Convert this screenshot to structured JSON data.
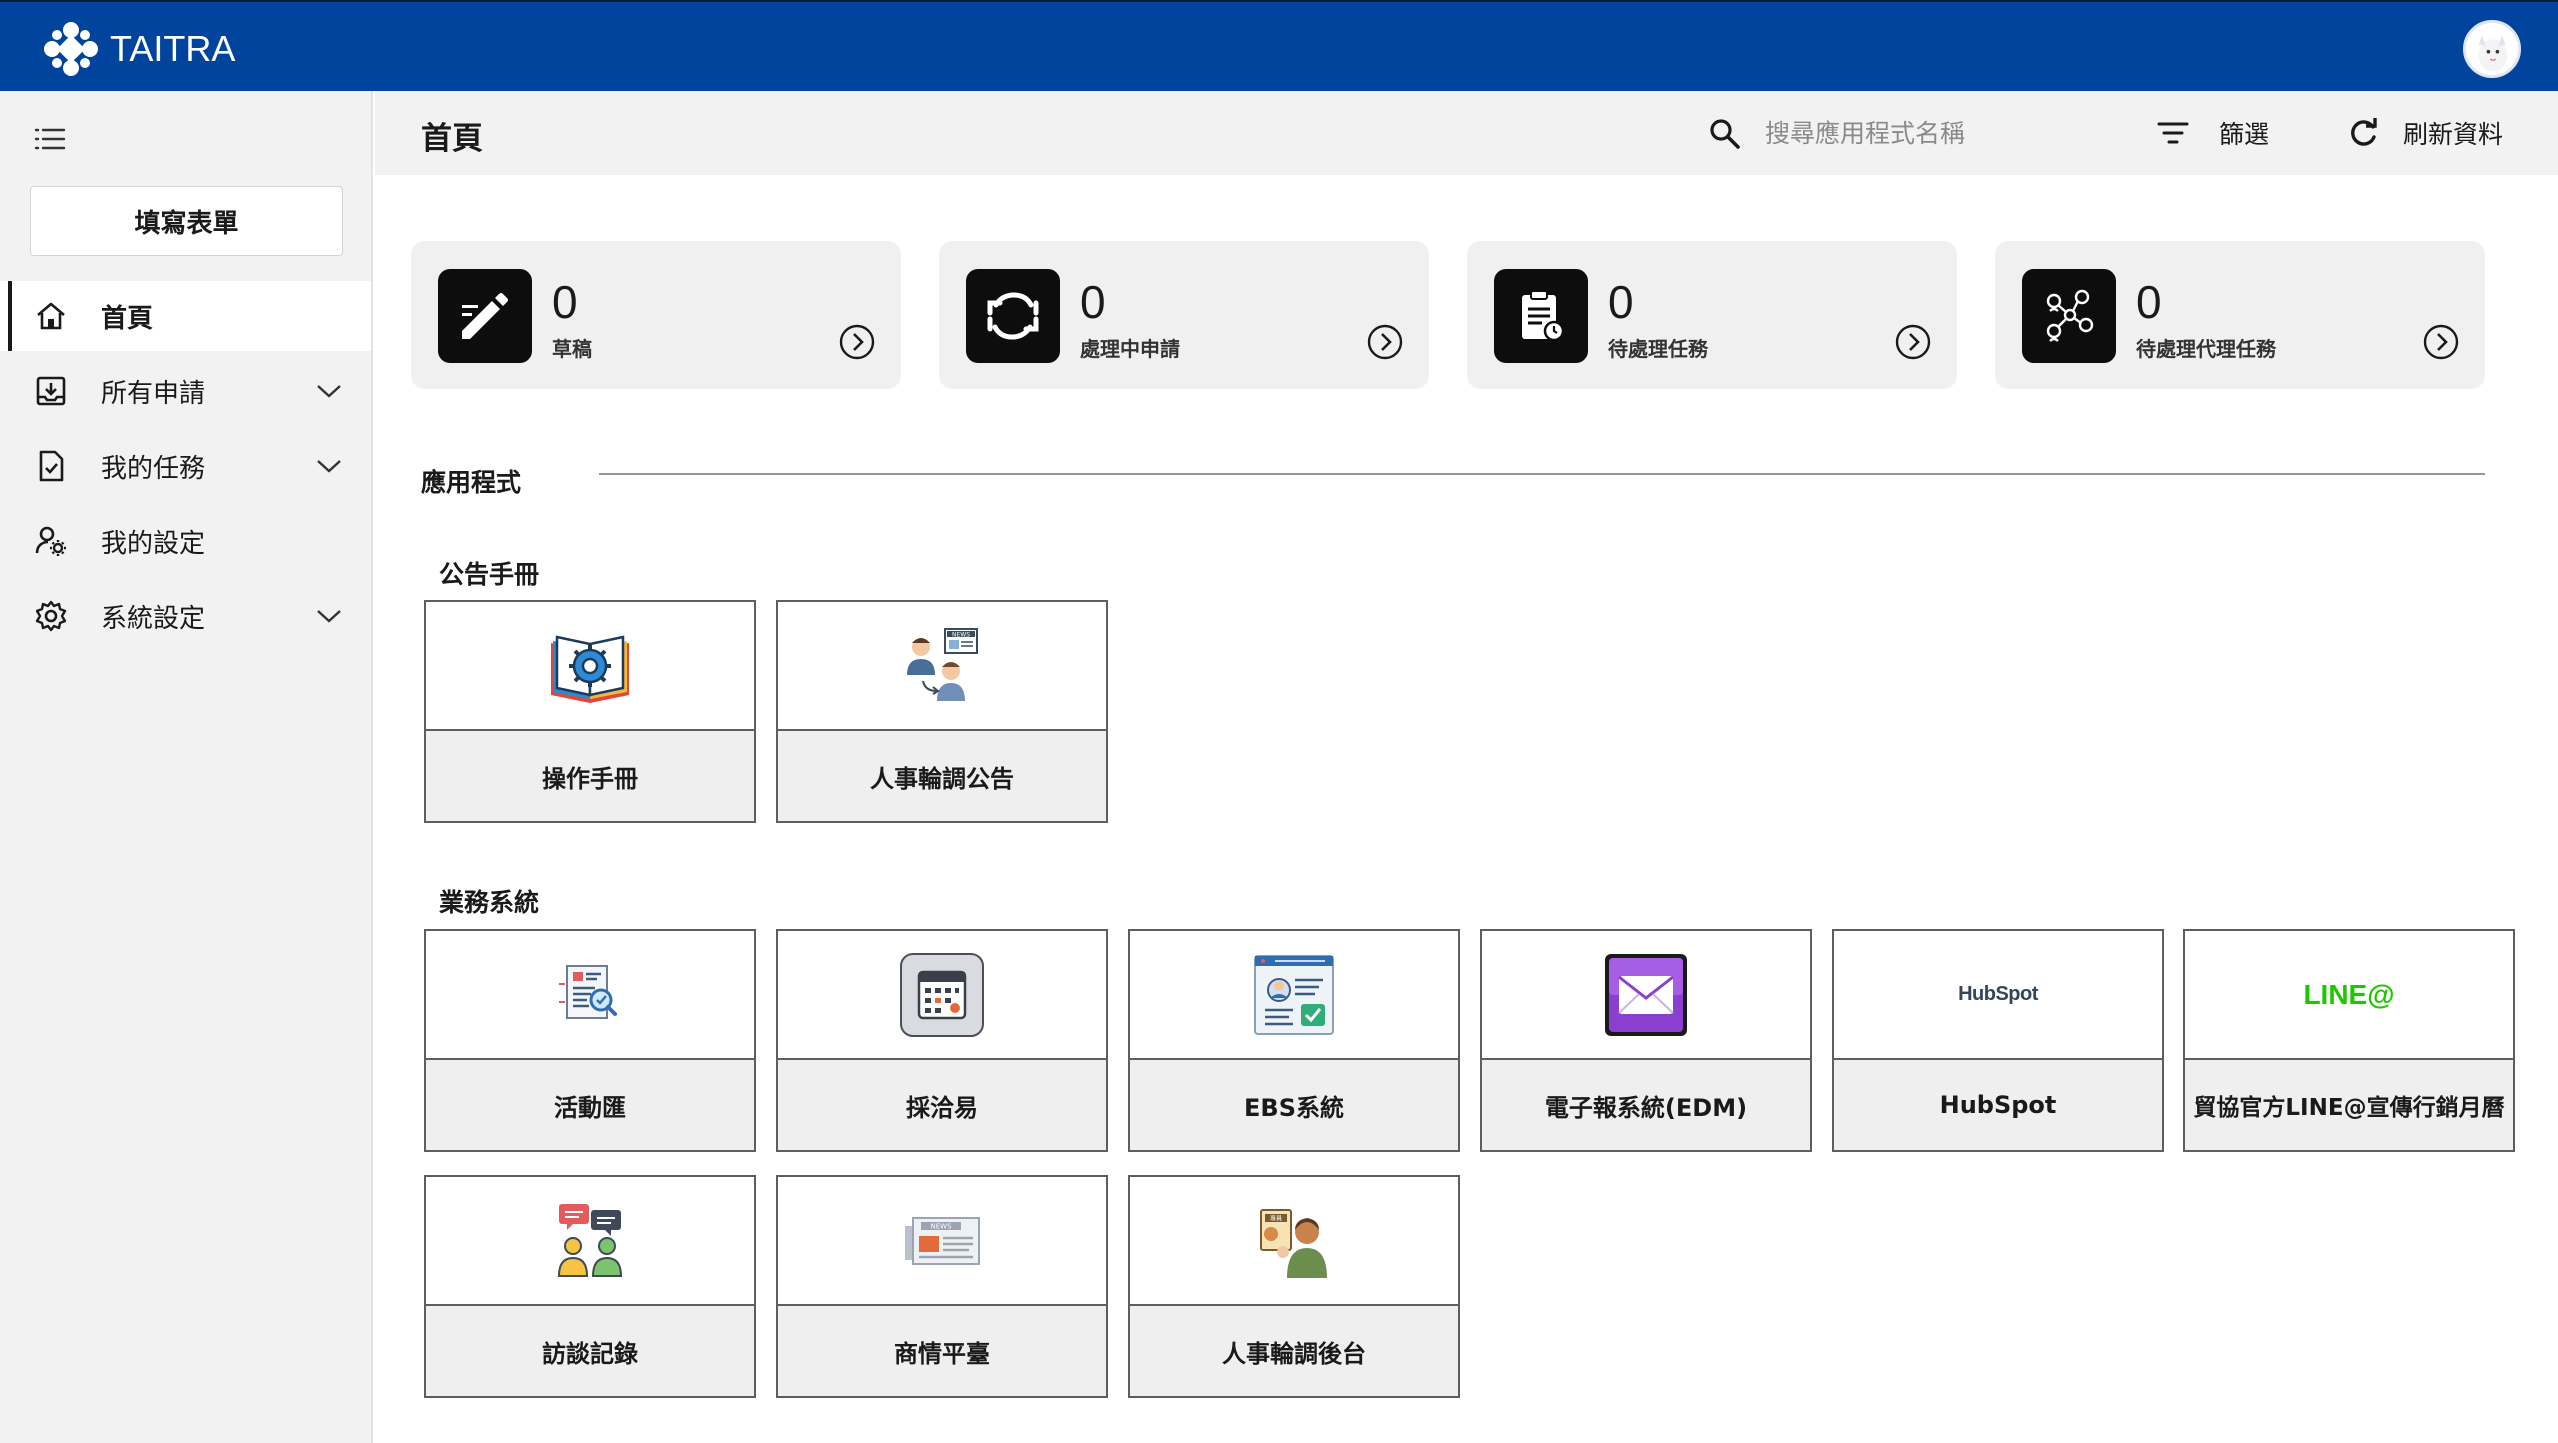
{
  "brand": {
    "name": "TAITRA"
  },
  "sidebar": {
    "fill_form_label": "填寫表單",
    "items": [
      {
        "label": "首頁",
        "icon": "home-icon"
      },
      {
        "label": "所有申請",
        "icon": "inbox-download-icon"
      },
      {
        "label": "我的任務",
        "icon": "task-check-icon"
      },
      {
        "label": "我的設定",
        "icon": "user-settings-icon"
      },
      {
        "label": "系統設定",
        "icon": "gear-icon"
      }
    ]
  },
  "header": {
    "title": "首頁",
    "search_placeholder": "搜尋應用程式名稱",
    "filter_label": "篩選",
    "refresh_label": "刷新資料"
  },
  "stats": [
    {
      "count": "0",
      "label": "草稿",
      "icon": "pencil-icon"
    },
    {
      "count": "0",
      "label": "處理中申請",
      "icon": "sync-icon"
    },
    {
      "count": "0",
      "label": "待處理任務",
      "icon": "clipboard-clock-icon"
    },
    {
      "count": "0",
      "label": "待處理代理任務",
      "icon": "delegate-network-icon"
    }
  ],
  "apps_section": {
    "title": "應用程式"
  },
  "groups": [
    {
      "title": "公告手冊",
      "apps": [
        {
          "label": "操作手冊",
          "icon": "manual-book-gear-icon"
        },
        {
          "label": "人事輪調公告",
          "icon": "personnel-news-icon"
        }
      ]
    },
    {
      "title": "業務系統",
      "apps": [
        {
          "label": "活動匯",
          "icon": "document-search-icon"
        },
        {
          "label": "採洽易",
          "icon": "calendar-app-icon"
        },
        {
          "label": "EBS系統",
          "icon": "id-card-form-icon"
        },
        {
          "label": "電子報系統(EDM)",
          "icon": "mail-envelope-icon"
        },
        {
          "label": "HubSpot",
          "icon": "hubspot-logo-icon",
          "logo_text": "HubSpot"
        },
        {
          "label": "貿協官方LINE@宣傳行銷月曆",
          "icon": "line-at-logo-icon",
          "logo_text": "LINE@"
        },
        {
          "label": "訪談記錄",
          "icon": "interview-chat-icon"
        },
        {
          "label": "商情平臺",
          "icon": "newspaper-icon"
        },
        {
          "label": "人事輪調後台",
          "icon": "personnel-admin-icon"
        }
      ]
    }
  ],
  "colors": {
    "topbar": "#00449e",
    "sidebar_bg": "#f2f2f2",
    "tile_border": "#5e5e5e",
    "line_green": "#1ec800",
    "hubspot_orange": "#ff7a59"
  }
}
